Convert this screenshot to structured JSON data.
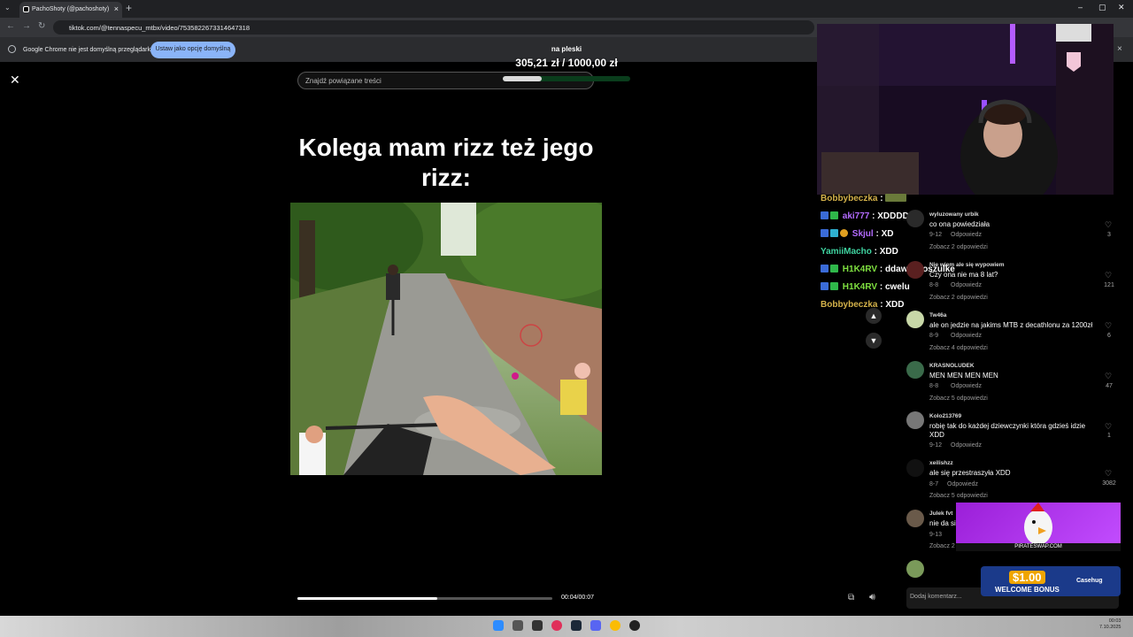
{
  "browser": {
    "tab_title": "PachoShoty (@pachoshoty)",
    "url": "tiktok.com/@tennaspecu_mtbx/video/7535822673314647318",
    "info_text": "Google Chrome nie jest domyślną przeglądarką",
    "info_button": "Ustaw jako opcję domyślną"
  },
  "goal": {
    "label": "na pleski",
    "amount": "305,21 zł / 1000,00 zł",
    "progress_fraction": 0.305
  },
  "tiktok": {
    "search_placeholder": "Znajdź powiązane treści",
    "caption": "Kolega mam rizz też jego rizz:",
    "time": "00:04/00:07",
    "progress_fraction": 0.55,
    "add_comment_placeholder": "Dodaj komentarz..."
  },
  "stream_chat": [
    {
      "user": "Bobbybeczka",
      "message": "",
      "color": "#d4b24a"
    },
    {
      "user": "aki777",
      "message": "XDDDD",
      "color": "#b36bff"
    },
    {
      "user": "Skjul",
      "message": "XD",
      "color": "#b36bff"
    },
    {
      "user": "YamiiMacho",
      "message": "XDD",
      "color": "#3fd3a0"
    },
    {
      "user": "H1K4RV",
      "message": "ddawaj koszulke",
      "color": "#7fe040"
    },
    {
      "user": "H1K4RV",
      "message": "cwelu",
      "color": "#7fe040"
    },
    {
      "user": "Bobbybeczka",
      "message": "XDD",
      "color": "#d4b24a"
    }
  ],
  "comments": [
    {
      "user": "wyluzowany urbik",
      "text": "co ona powiedziała",
      "date": "9-12",
      "reply": "Odpowiedz",
      "more": "Zobacz 2 odpowiedzi",
      "likes": "3"
    },
    {
      "user": "Nie wiem ale się wypowiem",
      "text": "Czy ona nie ma 8 lat?",
      "date": "8-8",
      "reply": "Odpowiedz",
      "more": "Zobacz 2 odpowiedzi",
      "likes": "121"
    },
    {
      "user": "Tw46a",
      "text": "ale on jedzie na jakims MTB z decathlonu za 1200zł",
      "date": "8-9",
      "reply": "Odpowiedz",
      "more": "Zobacz 4 odpowiedzi",
      "likes": "6"
    },
    {
      "user": "KRASNOLUDEK",
      "text": "MEN MEN MEN MEN",
      "date": "8-8",
      "reply": "Odpowiedz",
      "more": "Zobacz 5 odpowiedzi",
      "likes": "47"
    },
    {
      "user": "Kolo213769",
      "text": "robię tak do każdej dziewczynki która gdzieś idzie XDD",
      "date": "9-12",
      "reply": "Odpowiedz",
      "more": "",
      "likes": "1"
    },
    {
      "user": "xeilishzz",
      "text": "ale się przestraszyła XDD",
      "date": "8-7",
      "reply": "Odpowiedz",
      "more": "Zobacz 5 odpowiedzi",
      "likes": "3082"
    },
    {
      "user": "Julek fvt",
      "text": "nie da si",
      "date": "9-13",
      "reply": "",
      "more": "Zobacz 2",
      "likes": ""
    }
  ],
  "ad": {
    "url": "PIRATESWAP.COM",
    "amount": "$1.00",
    "bonus": "WELCOME BONUS",
    "brand": "Casehug"
  },
  "taskbar": {
    "time": "00:03",
    "date": "7.10.2025"
  },
  "icons": [
    "close-icon",
    "search-icon",
    "heart-icon",
    "chevron-up-icon",
    "chevron-down-icon",
    "volume-icon"
  ]
}
